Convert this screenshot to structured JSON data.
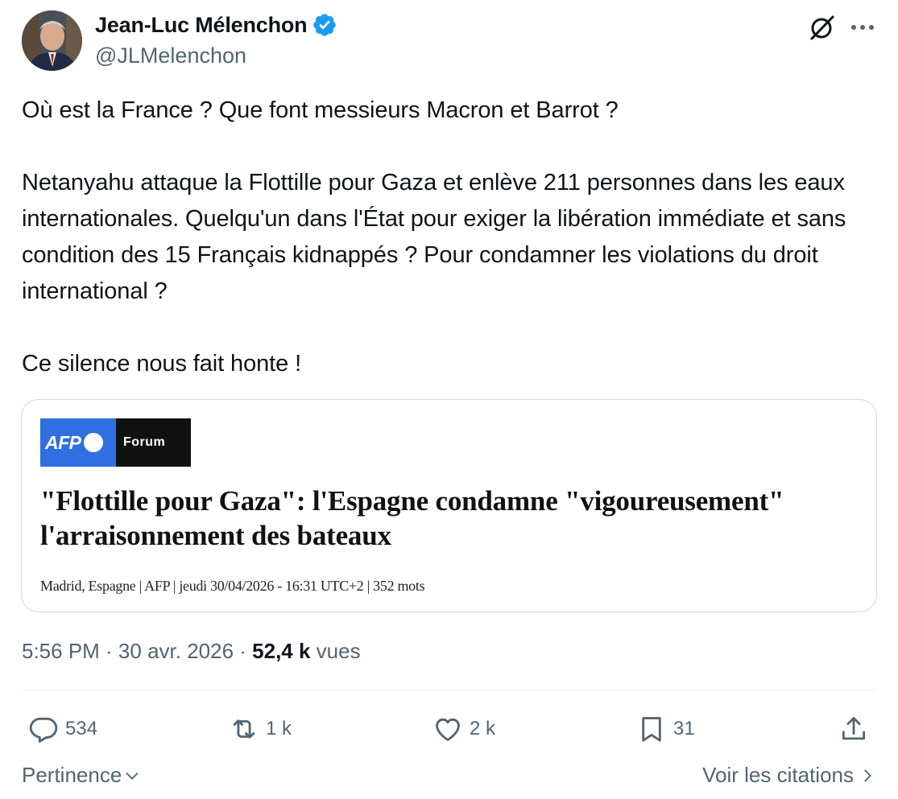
{
  "author": {
    "name": "Jean-Luc Mélenchon",
    "handle": "@JLMelenchon",
    "verified_color": "#1d9bf0"
  },
  "tweet": {
    "text": "Où est la France ? Que font messieurs Macron et Barrot ?\n\nNetanyahu attaque la Flottille pour Gaza et enlève 211 personnes dans les eaux internationales. Quelqu'un dans l'État pour exiger la libération immédiate et sans condition des 15 Français kidnappés ? Pour condamner les violations du droit international ?\n\nCe silence nous fait honte !"
  },
  "card": {
    "logo_text": "AFP",
    "badge": "Forum",
    "headline": "\"Flottille pour Gaza\": l'Espagne condamne \"vigoureusement\" l'arraisonnement des bateaux",
    "meta": "Madrid, Espagne | AFP | jeudi 30/04/2026 - 16:31 UTC+2 | 352 mots"
  },
  "stats": {
    "time": "5:56 PM · 30 avr. 2026 · ",
    "views": "52,4 k",
    "views_label": " vues"
  },
  "actions": {
    "replies": "534",
    "reposts": "1 k",
    "likes": "2 k",
    "bookmarks": "31"
  },
  "footer": {
    "sort_label": "Pertinence",
    "quotes_label": "Voir les citations"
  },
  "icons": [
    "avatar",
    "verified-badge-icon",
    "grok-icon",
    "more-icon",
    "reply-icon",
    "repost-icon",
    "like-icon",
    "bookmark-icon",
    "share-icon",
    "chevron-down-icon",
    "chevron-right-icon"
  ],
  "colors": {
    "text_primary": "#0f1419",
    "text_secondary": "#536471",
    "afp_blue": "#2f6fe0",
    "border": "#cfd9de"
  }
}
